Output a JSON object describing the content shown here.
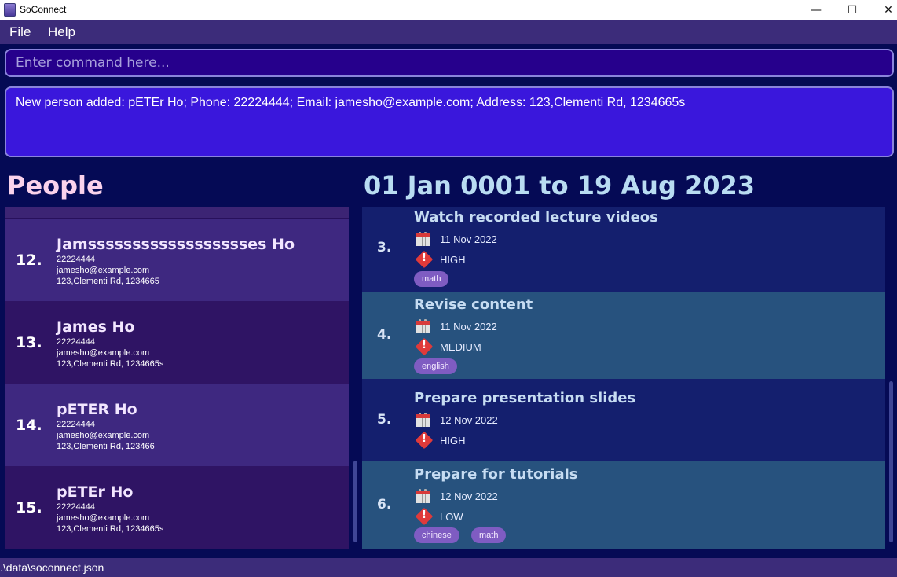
{
  "window": {
    "title": "SoConnect",
    "minimize": "—",
    "maximize": "☐",
    "close": "✕"
  },
  "menu": {
    "file": "File",
    "help": "Help"
  },
  "command": {
    "placeholder": "Enter command here...",
    "value": ""
  },
  "result": {
    "text": "New person added: pETEr Ho; Phone: 22224444; Email: jamesho@example.com; Address: 123,Clementi Rd, 1234665s"
  },
  "people": {
    "heading": "People",
    "cards": [
      {
        "index": "12.",
        "name": "Jamsssssssssssssssssses Ho",
        "phone": "22224444",
        "email": "jamesho@example.com",
        "address": "123,Clementi Rd, 1234665"
      },
      {
        "index": "13.",
        "name": "James Ho",
        "phone": "22224444",
        "email": "jamesho@example.com",
        "address": "123,Clementi Rd, 1234665s"
      },
      {
        "index": "14.",
        "name": "pETER Ho",
        "phone": "22224444",
        "email": "jamesho@example.com",
        "address": "123,Clementi Rd, 123466"
      },
      {
        "index": "15.",
        "name": "pETEr Ho",
        "phone": "22224444",
        "email": "jamesho@example.com",
        "address": "123,Clementi Rd, 1234665s"
      }
    ]
  },
  "tasks": {
    "heading": "01 Jan 0001 to 19 Aug 2023",
    "cards": [
      {
        "index": "3.",
        "title": "Watch recorded lecture videos",
        "date": "11 Nov 2022",
        "priority": "HIGH",
        "tags": [
          "math"
        ]
      },
      {
        "index": "4.",
        "title": "Revise content",
        "date": "11 Nov 2022",
        "priority": "MEDIUM",
        "tags": [
          "english"
        ]
      },
      {
        "index": "5.",
        "title": "Prepare presentation slides",
        "date": "12 Nov 2022",
        "priority": "HIGH",
        "tags": []
      },
      {
        "index": "6.",
        "title": "Prepare for tutorials",
        "date": "12 Nov 2022",
        "priority": "LOW",
        "tags": [
          "chinese",
          "math"
        ]
      }
    ]
  },
  "status": {
    "path": ".\\data\\soconnect.json"
  }
}
